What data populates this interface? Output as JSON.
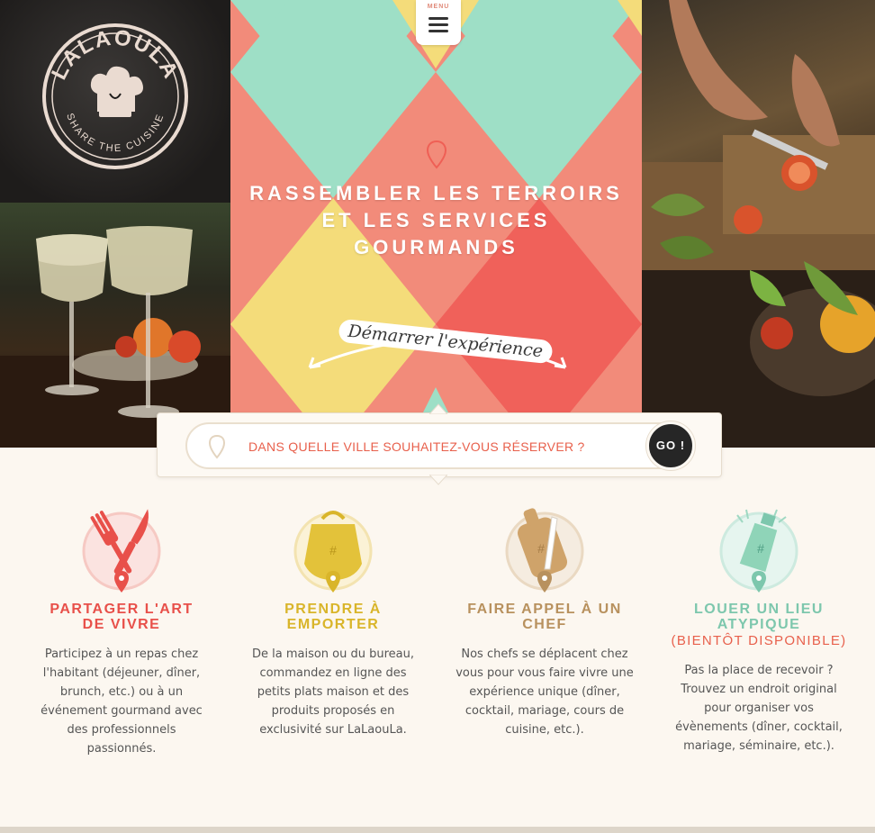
{
  "brand": {
    "name": "LALAOULA",
    "tagline": "SHARE THE CUISINE"
  },
  "menu": {
    "label": "MENU"
  },
  "hero": {
    "title_lines": [
      "RASSEMBLER LES TERROIRS",
      "ET LES SERVICES",
      "GOURMANDS"
    ],
    "cta": "Démarrer l'expérience"
  },
  "search": {
    "placeholder": "DANS QUELLE VILLE SOUHAITEZ-VOUS RÉSERVER ?",
    "button": "GO !"
  },
  "features": [
    {
      "title_lines": [
        "PARTAGER L'ART",
        "DE VIVRE"
      ],
      "soon": "",
      "color": "#e8504a",
      "icon": "cutlery-icon",
      "text": "Participez à un repas chez l'habitant (déjeuner, dîner, brunch, etc.) ou à un événement gourmand avec des professionnels passionnés."
    },
    {
      "title_lines": [
        "PRENDRE À",
        "EMPORTER"
      ],
      "soon": "",
      "color": "#d9b52a",
      "icon": "bag-icon",
      "text": "De la maison ou du bureau, commandez en ligne des petits plats maison et des produits proposés en exclusivité sur LaLaouLa."
    },
    {
      "title_lines": [
        "FAIRE APPEL À UN",
        "CHEF"
      ],
      "soon": "",
      "color": "#b8915e",
      "icon": "knife-board-icon",
      "text": "Nos chefs se déplacent chez vous pour vous faire vivre une expérience unique (dîner, cocktail, mariage, cours de cuisine, etc.)."
    },
    {
      "title_lines": [
        "LOUER UN LIEU",
        "ATYPIQUE"
      ],
      "soon": "(BIENTÔT DISPONIBLE)",
      "color": "#7dc7ad",
      "icon": "bottle-icon",
      "text": "Pas la place de recevoir ? Trouvez un endroit original pour organiser vos évènements (dîner, cocktail, mariage, séminaire, etc.)."
    }
  ],
  "colors": {
    "coral": "#f28b7a",
    "red": "#f0615a",
    "mint": "#9edfc6",
    "yellow": "#f4dc7a",
    "background": "#fcf7f0",
    "dark": "#262626"
  }
}
